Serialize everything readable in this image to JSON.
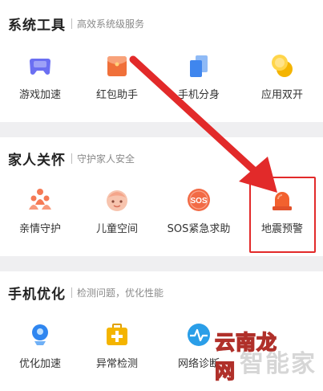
{
  "sections": [
    {
      "title": "系统工具",
      "subtitle": "高效系统级服务",
      "items": [
        {
          "label": "游戏加速",
          "icon": "gamepad-icon",
          "color": "#6b6ff2"
        },
        {
          "label": "红包助手",
          "icon": "red-envelope-icon",
          "color": "#f0703a"
        },
        {
          "label": "手机分身",
          "icon": "dual-phone-icon",
          "color": "#3f86ee"
        },
        {
          "label": "应用双开",
          "icon": "dual-coin-icon",
          "color": "#f4b400"
        }
      ]
    },
    {
      "title": "家人关怀",
      "subtitle": "守护家人安全",
      "items": [
        {
          "label": "亲情守护",
          "icon": "family-icon",
          "color": "#f57a55"
        },
        {
          "label": "儿童空间",
          "icon": "child-face-icon",
          "color": "#f4a58a"
        },
        {
          "label": "SOS紧急求助",
          "icon": "sos-icon",
          "color": "#f26a45",
          "badge": "SOS"
        },
        {
          "label": "地震预警",
          "icon": "alarm-light-icon",
          "color": "#f2612e"
        }
      ]
    },
    {
      "title": "手机优化",
      "subtitle": "检测问题，优化性能",
      "items": [
        {
          "label": "优化加速",
          "icon": "rocket-icon",
          "color": "#2f86f0"
        },
        {
          "label": "异常检测",
          "icon": "medical-kit-icon",
          "color": "#f4b400"
        },
        {
          "label": "网络诊断",
          "icon": "network-pulse-icon",
          "color": "#2a9ee8"
        }
      ]
    }
  ],
  "watermark": {
    "back": "智能家",
    "front": "云南龙网"
  },
  "colors": {
    "annotation": "#e22a2a"
  }
}
